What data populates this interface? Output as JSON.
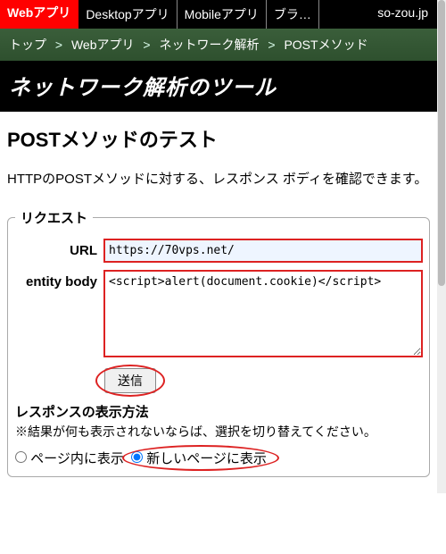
{
  "topbar": {
    "tabs": [
      "Webアプリ",
      "Desktopアプリ",
      "Mobileアプリ",
      "ブラ…"
    ],
    "brand": "so-zou.jp"
  },
  "breadcrumb": {
    "items": [
      "トップ",
      "Webアプリ",
      "ネットワーク解析",
      "POSTメソッド"
    ],
    "sep": ">"
  },
  "banner": {
    "title": "ネットワーク解析のツール"
  },
  "page": {
    "heading": "POSTメソッドのテスト",
    "lead": "HTTPのPOSTメソッドに対する、レスポンス ボディを確認できます。"
  },
  "request": {
    "legend": "リクエスト",
    "url_label": "URL",
    "url_value": "https://70vps.net/",
    "body_label": "entity body",
    "body_value": "<script>alert(document.cookie)</script>",
    "submit_label": "送信"
  },
  "response": {
    "heading": "レスポンスの表示方法",
    "note": "※結果が何も表示されないならば、選択を切り替えてください。",
    "opt_inline": "ページ内に表示",
    "opt_newpage": "新しいページに表示"
  }
}
